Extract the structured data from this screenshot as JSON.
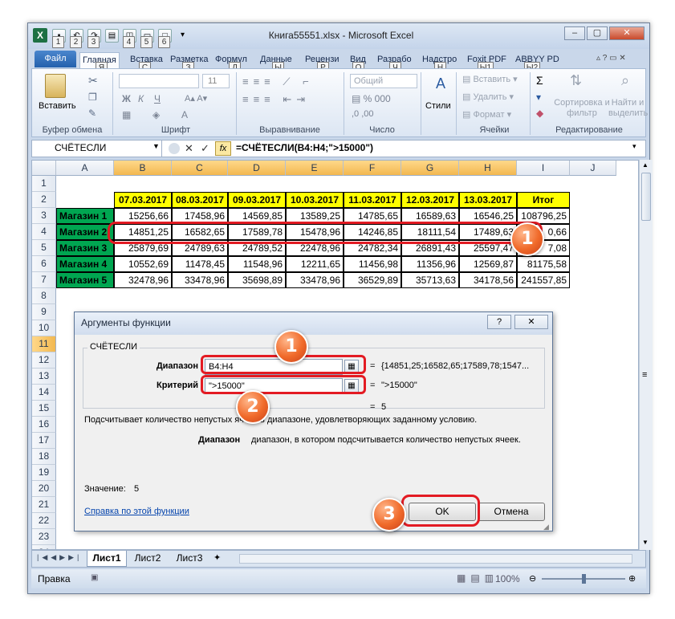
{
  "window": {
    "title": "Книга55551.xlsx - Microsoft Excel",
    "qat_keys": [
      "1",
      "2",
      "3",
      "4",
      "5",
      "6"
    ]
  },
  "ribbon": {
    "tabs": [
      {
        "label": "Файл"
      },
      {
        "label": "Главная",
        "key": "Я"
      },
      {
        "label": "Вставка",
        "key": "С"
      },
      {
        "label": "Разметка",
        "key": "З"
      },
      {
        "label": "Формул",
        "key": "Л"
      },
      {
        "label": "Данные",
        "key": "Ы"
      },
      {
        "label": "Рецензи",
        "key": "Р"
      },
      {
        "label": "Вид",
        "key": "О"
      },
      {
        "label": "Разрабо",
        "key": "Ч"
      },
      {
        "label": "Надстро",
        "key": "Н"
      },
      {
        "label": "Foxit PDF",
        "key": "Ы1"
      },
      {
        "label": "ABBYY PD",
        "key": "Ы2"
      }
    ],
    "paste_label": "Вставить",
    "styles_label": "Стили",
    "font_size": "11",
    "number_format": "Общий",
    "cells_insert": "Вставить",
    "cells_delete": "Удалить",
    "cells_format": "Формат",
    "sum_symbol": "Σ",
    "sort_label": "Сортировка и фильтр",
    "find_label": "Найти и выделить",
    "groups": [
      "Буфер обмена",
      "Шрифт",
      "Выравнивание",
      "Число",
      "Ячейки",
      "Редактирование"
    ]
  },
  "formula_bar": {
    "name_box": "СЧЁТЕСЛИ",
    "fx": "fx",
    "formula": "=СЧЁТЕСЛИ(B4:H4;\">15000\")"
  },
  "sheet": {
    "columns": [
      "A",
      "B",
      "C",
      "D",
      "E",
      "F",
      "G",
      "H",
      "I",
      "J"
    ],
    "rows": [
      "1",
      "2",
      "3",
      "4",
      "5",
      "6",
      "7",
      "8",
      "9",
      "10",
      "11",
      "12",
      "13",
      "14",
      "15",
      "16",
      "17",
      "18",
      "19",
      "20",
      "21",
      "22",
      "23",
      "24"
    ],
    "headers": [
      "07.03.2017",
      "08.03.2017",
      "09.03.2017",
      "10.03.2017",
      "11.03.2017",
      "12.03.2017",
      "13.03.2017",
      "Итог"
    ],
    "data": [
      {
        "shop": "Магазин 1",
        "values": [
          "15256,66",
          "17458,96",
          "14569,85",
          "13589,25",
          "14785,65",
          "16589,63",
          "16546,25",
          "108796,25"
        ]
      },
      {
        "shop": "Магазин 2",
        "values": [
          "14851,25",
          "16582,65",
          "17589,78",
          "15478,96",
          "14246,85",
          "18111,54",
          "17489,63",
          "0,66"
        ]
      },
      {
        "shop": "Магазин 3",
        "values": [
          "25879,69",
          "24789,63",
          "24789,52",
          "22478,96",
          "24782,34",
          "26891,43",
          "25597,47",
          "7,08"
        ]
      },
      {
        "shop": "Магазин 4",
        "values": [
          "10552,69",
          "11478,45",
          "11548,96",
          "12211,65",
          "11456,98",
          "11356,96",
          "12569,87",
          "81175,58"
        ]
      },
      {
        "shop": "Магазин 5",
        "values": [
          "32478,96",
          "33478,96",
          "35698,89",
          "33478,96",
          "36529,89",
          "35713,63",
          "34178,56",
          "241557,85"
        ]
      }
    ],
    "tabs": [
      "Лист1",
      "Лист2",
      "Лист3"
    ]
  },
  "status": {
    "mode": "Правка",
    "zoom": "100%"
  },
  "dialog": {
    "title": "Аргументы функции",
    "function_name": "СЧЁТЕСЛИ",
    "range_label": "Диапазон",
    "range_value": "B4:H4",
    "range_result": "{14851,25;16582,65;17589,78;1547...",
    "criteria_label": "Критерий",
    "criteria_value": "\">15000\"",
    "criteria_result": "\">15000\"",
    "equals": "=",
    "result_value": "5",
    "description": "Подсчитывает количество непустых ячеек в диапазоне, удовлетворяющих заданному условию.",
    "arg_help_name": "Диапазон",
    "arg_help_text": "диапазон, в котором подсчитывается количество непустых ячеек.",
    "value_label": "Значение:",
    "value": "5",
    "help_link": "Справка по этой функции",
    "ok": "OK",
    "cancel": "Отмена",
    "help_btn": "?",
    "close_btn": "✕"
  },
  "annotations": {
    "badge_row": "1",
    "badge_range": "1",
    "badge_criteria": "2",
    "badge_ok": "3",
    "accent": "#e31b23"
  }
}
